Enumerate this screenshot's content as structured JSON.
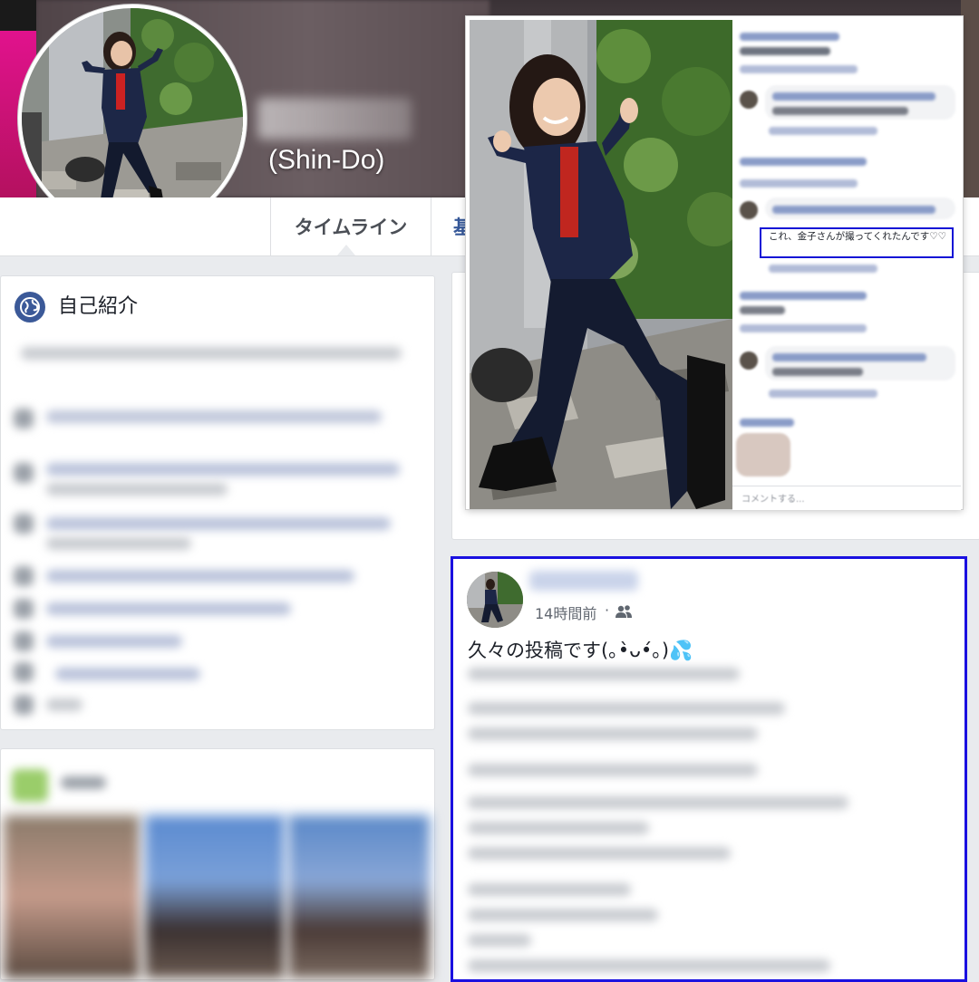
{
  "profile": {
    "name_suffix": "(Shin-Do)"
  },
  "nav": {
    "tab_timeline": "タイムライン",
    "tab_about_partial": "基"
  },
  "intro": {
    "title": "自己紹介",
    "icon": "globe-icon"
  },
  "comments_overlay": {
    "highlighted_comment": "これ、金子さんが撮ってくれたんです♡♡",
    "input_placeholder": "コメントする..."
  },
  "post": {
    "time": "14時間前",
    "separator": "·",
    "audience_icon": "friends-icon",
    "text": "久々の投稿です(｡•̀ᴗ•́｡)💦"
  },
  "colors": {
    "facebook_blue": "#3b5998",
    "highlight_border": "#1a10e0",
    "cover_pink": "#e1128d",
    "page_bg": "#e9ebee"
  }
}
